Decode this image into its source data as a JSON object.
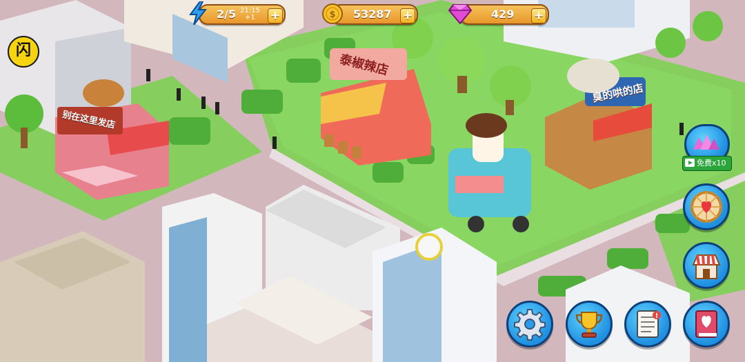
{
  "hud": {
    "energy": {
      "icon": "lightning-icon",
      "value": "2/5",
      "timer": "21:15",
      "regen": "+1"
    },
    "coins": {
      "icon": "coin-icon",
      "value": "53287"
    },
    "gems": {
      "icon": "gem-icon",
      "value": "429"
    },
    "plus_label": "+"
  },
  "logo": {
    "text": "闪"
  },
  "shops": [
    {
      "name": "别在这里发店",
      "icon": "bakery-shop-icon"
    },
    {
      "name": "泰椒辣店",
      "icon": "spicy-shop-icon"
    },
    {
      "name": "臭的哄的店",
      "icon": "bbq-shop-icon"
    }
  ],
  "side_buttons": {
    "gems_offer": {
      "icon": "gem-pile-icon",
      "ad_label": "免费x10"
    },
    "wheel": {
      "icon": "wheel-icon"
    },
    "shop": {
      "icon": "shop-icon"
    },
    "book": {
      "icon": "heart-book-icon"
    }
  },
  "bottom_buttons": {
    "settings": {
      "icon": "gear-icon"
    },
    "trophy": {
      "icon": "trophy-icon"
    },
    "tasks": {
      "icon": "checklist-icon"
    }
  },
  "colors": {
    "grass": "#7fcc58",
    "road": "#d7b8bf",
    "hud_pill": "#eea33b",
    "button_blue": "#2a9be8"
  }
}
